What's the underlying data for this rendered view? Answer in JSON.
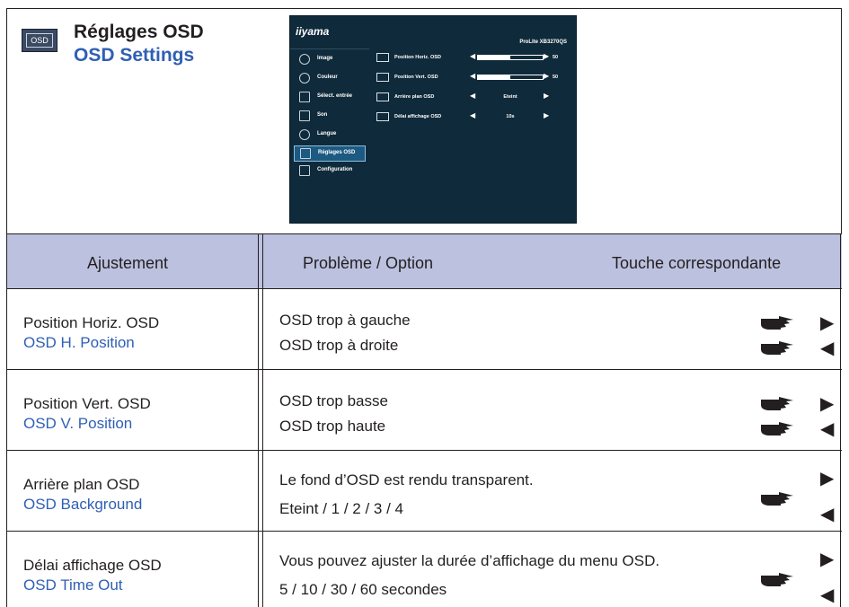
{
  "header": {
    "icon_label": "OSD",
    "title_fr": "Réglages OSD",
    "title_en": "OSD Settings"
  },
  "osd_screen": {
    "logo": "iiyama",
    "model": "ProLite XB3270QS",
    "menu": [
      {
        "label": "Image",
        "icon": "image-icon"
      },
      {
        "label": "Couleur",
        "icon": "color-icon"
      },
      {
        "label": "Sélect. entrée",
        "icon": "input-icon"
      },
      {
        "label": "Son",
        "icon": "speaker-icon"
      },
      {
        "label": "Langue",
        "icon": "globe-icon"
      },
      {
        "label": "Réglages OSD",
        "icon": "osd-icon",
        "selected": true
      },
      {
        "label": "Configuration",
        "icon": "sliders-icon"
      }
    ],
    "settings": [
      {
        "label": "Position Horiz. OSD",
        "type": "bar",
        "value": "50",
        "level": 0.5
      },
      {
        "label": "Position Vert. OSD",
        "type": "bar",
        "value": "50",
        "level": 0.5
      },
      {
        "label": "Arrière plan OSD",
        "type": "option",
        "value": "Eteint"
      },
      {
        "label": "Délai affichage OSD",
        "type": "option",
        "value": "10s"
      }
    ]
  },
  "table": {
    "headers": {
      "adjustment": "Ajustement",
      "problem": "Problème / Option",
      "key": "Touche correspondante"
    },
    "rows": [
      {
        "adj_fr": "Position Horiz. OSD",
        "adj_en": "OSD H. Position",
        "lines": [
          "OSD trop à gauche",
          "OSD trop à droite"
        ]
      },
      {
        "adj_fr": "Position Vert. OSD",
        "adj_en": "OSD V. Position",
        "lines": [
          "OSD trop basse",
          "OSD trop haute"
        ]
      },
      {
        "adj_fr": "Arrière plan OSD",
        "adj_en": "OSD Background",
        "lines": [
          "Le fond d’OSD est rendu transparent.",
          "Eteint / 1 / 2 / 3 / 4"
        ]
      },
      {
        "adj_fr": "Délai affichage OSD",
        "adj_en": "OSD Time Out",
        "lines": [
          "Vous pouvez ajuster la durée d’affichage du menu OSD.",
          "5 / 10 / 30 / 60 secondes"
        ]
      }
    ],
    "key_right_glyph": "▶",
    "key_left_glyph": "◀"
  }
}
